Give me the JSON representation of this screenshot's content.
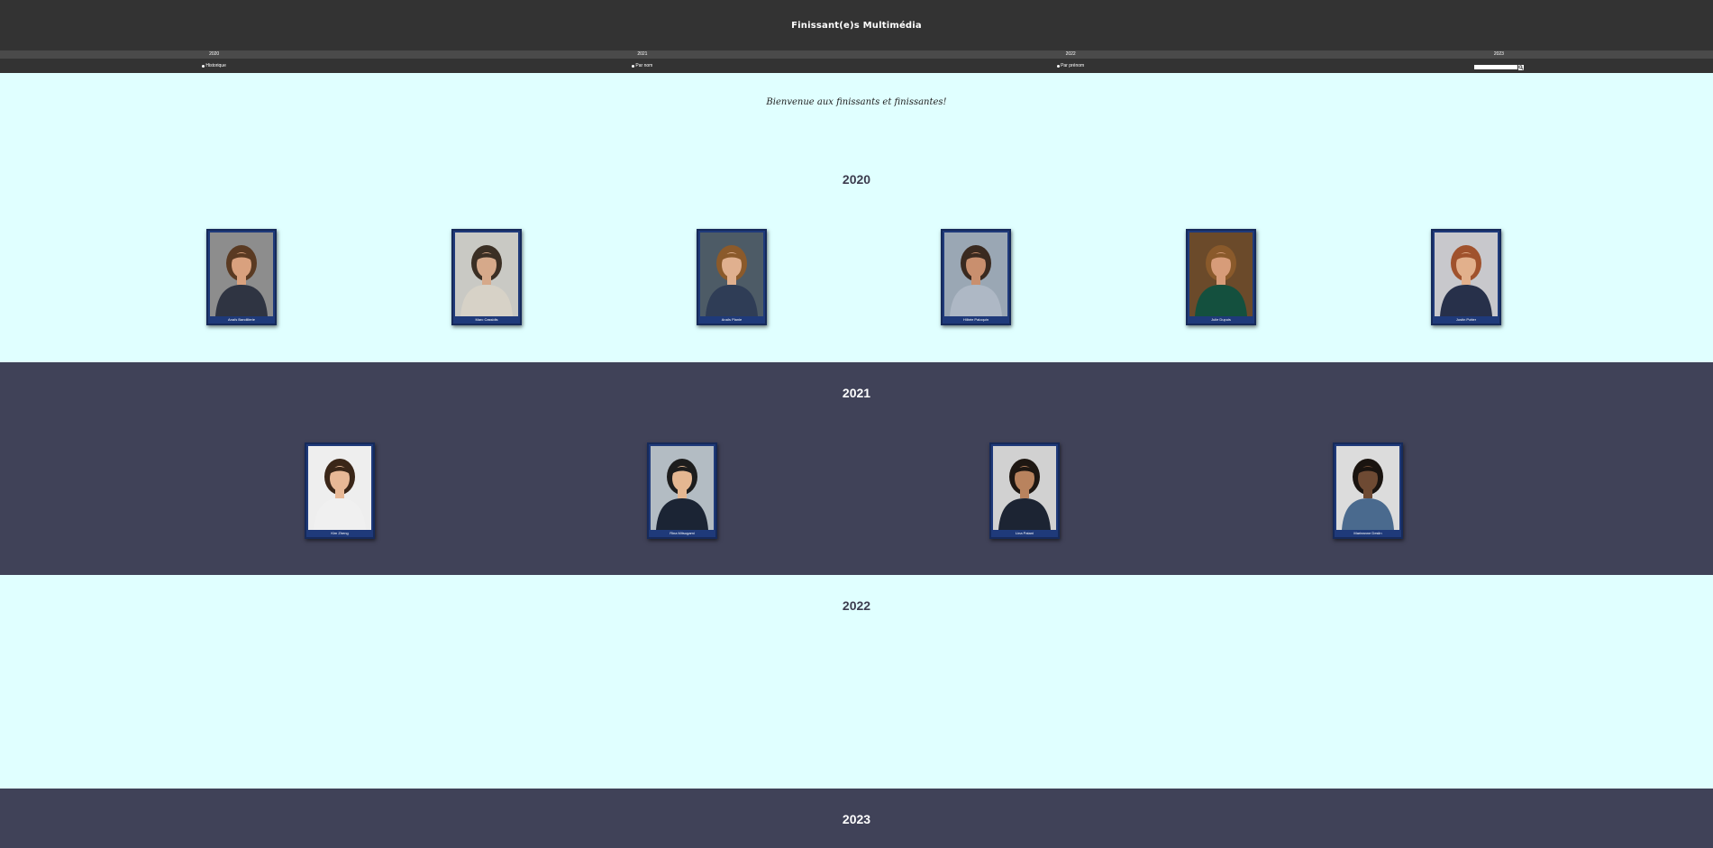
{
  "header": {
    "title": "Finissant(e)s Multimédia"
  },
  "year_nav": [
    "2020",
    "2021",
    "2022",
    "2023"
  ],
  "sort_bar": {
    "options": [
      "Historique",
      "Par nom",
      "Par prénom"
    ],
    "search_placeholder": ""
  },
  "welcome": "Bienvenue aux finissants et finissantes!",
  "sections": [
    {
      "year": "2020",
      "students": [
        {
          "name": "Anaïs Bandillerie",
          "bg": "#8d8d8d",
          "hair": "#5a3a22",
          "skin": "#d9a17e",
          "shirt": "#2f3442"
        },
        {
          "name": "Marc Cassidis",
          "bg": "#c9c9c4",
          "hair": "#3b2f24",
          "skin": "#d6a98a",
          "shirt": "#d7d2c7"
        },
        {
          "name": "Anaïs Planie",
          "bg": "#4d5b66",
          "hair": "#8b5a2b",
          "skin": "#e0b08f",
          "shirt": "#2f3d56"
        },
        {
          "name": "Hilbée Paloquin",
          "bg": "#9aa7b4",
          "hair": "#3a2a20",
          "skin": "#c98f6e",
          "shirt": "#aeb8c5"
        },
        {
          "name": "Julie Dupuis",
          "bg": "#6b4a2a",
          "hair": "#8a5a2b",
          "skin": "#d79c79",
          "shirt": "#14503e"
        },
        {
          "name": "Justin Potter",
          "bg": "#c8c8cc",
          "hair": "#a0522d",
          "skin": "#e2b08c",
          "shirt": "#27304a"
        }
      ]
    },
    {
      "year": "2021",
      "students": [
        {
          "name": "Kim Zheng",
          "bg": "#eeeeee",
          "hair": "#3a2618",
          "skin": "#e8b896",
          "shirt": "#f0f0f0"
        },
        {
          "name": "Rina Mitsugami",
          "bg": "#b3bcc3",
          "hair": "#1d1d1d",
          "skin": "#e5b791",
          "shirt": "#1b2434"
        },
        {
          "name": "Lina Patani",
          "bg": "#d1d1d1",
          "hair": "#1e1712",
          "skin": "#b9835e",
          "shirt": "#1c2433"
        },
        {
          "name": "Marieanne Deslin",
          "bg": "#dcdcdc",
          "hair": "#1a1410",
          "skin": "#6e4a33",
          "shirt": "#4a6a8e"
        }
      ]
    },
    {
      "year": "2022",
      "students": []
    },
    {
      "year": "2023",
      "students": []
    }
  ],
  "colors": {
    "header_bg": "#333333",
    "nav_bg": "#4a4a4a",
    "light_section": "#e0ffff",
    "dark_section": "#404258",
    "card_frame": "#1f3a7a"
  },
  "icons": {
    "search": "magnifier-icon",
    "radio": "radio-dot-icon"
  }
}
